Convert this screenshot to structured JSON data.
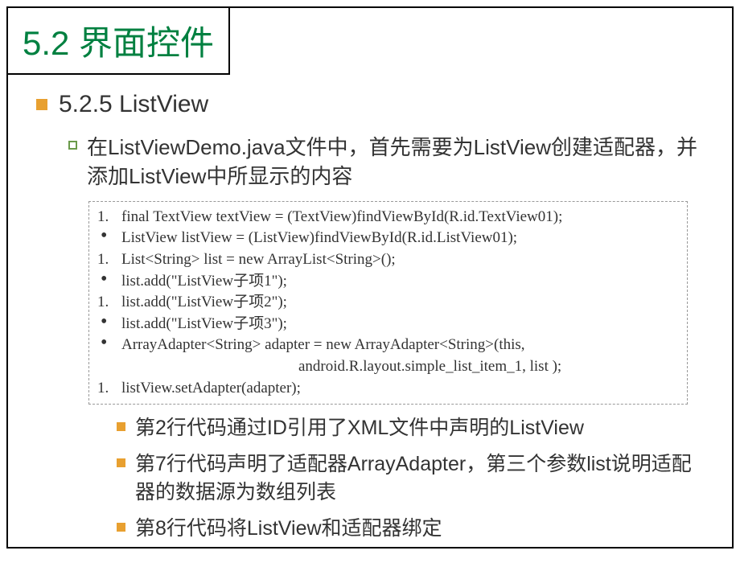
{
  "title": "5.2  界面控件",
  "section": {
    "number_title": "5.2.5 ListView",
    "description": "在ListViewDemo.java文件中，首先需要为ListView创建适配器，并添加ListView中所显示的内容"
  },
  "code": {
    "lines": [
      {
        "marker": "1.",
        "type": "num",
        "text": "final TextView textView = (TextView)findViewById(R.id.TextView01);"
      },
      {
        "marker": "•",
        "type": "dot",
        "text": "ListView listView = (ListView)findViewById(R.id.ListView01);"
      },
      {
        "marker": "1.",
        "type": "num",
        "text": "List<String> list  = new ArrayList<String>();"
      },
      {
        "marker": "•",
        "type": "dot",
        "text": "list.add(\"ListView子项1\");"
      },
      {
        "marker": "1.",
        "type": "num",
        "text": "list.add(\"ListView子项2\");"
      },
      {
        "marker": "•",
        "type": "dot",
        "text": "list.add(\"ListView子项3\");"
      },
      {
        "marker": "•",
        "type": "dot",
        "text": "ArrayAdapter<String> adapter = new ArrayAdapter<String>(this,"
      },
      {
        "marker": "",
        "type": "indent",
        "text": "android.R.layout.simple_list_item_1, list );"
      },
      {
        "marker": "1.",
        "type": "num",
        "text": "listView.setAdapter(adapter);"
      }
    ]
  },
  "notes": [
    "第2行代码通过ID引用了XML文件中声明的ListView",
    "第7行代码声明了适配器ArrayAdapter，第三个参数list说明适配器的数据源为数组列表",
    "第8行代码将ListView和适配器绑定"
  ]
}
